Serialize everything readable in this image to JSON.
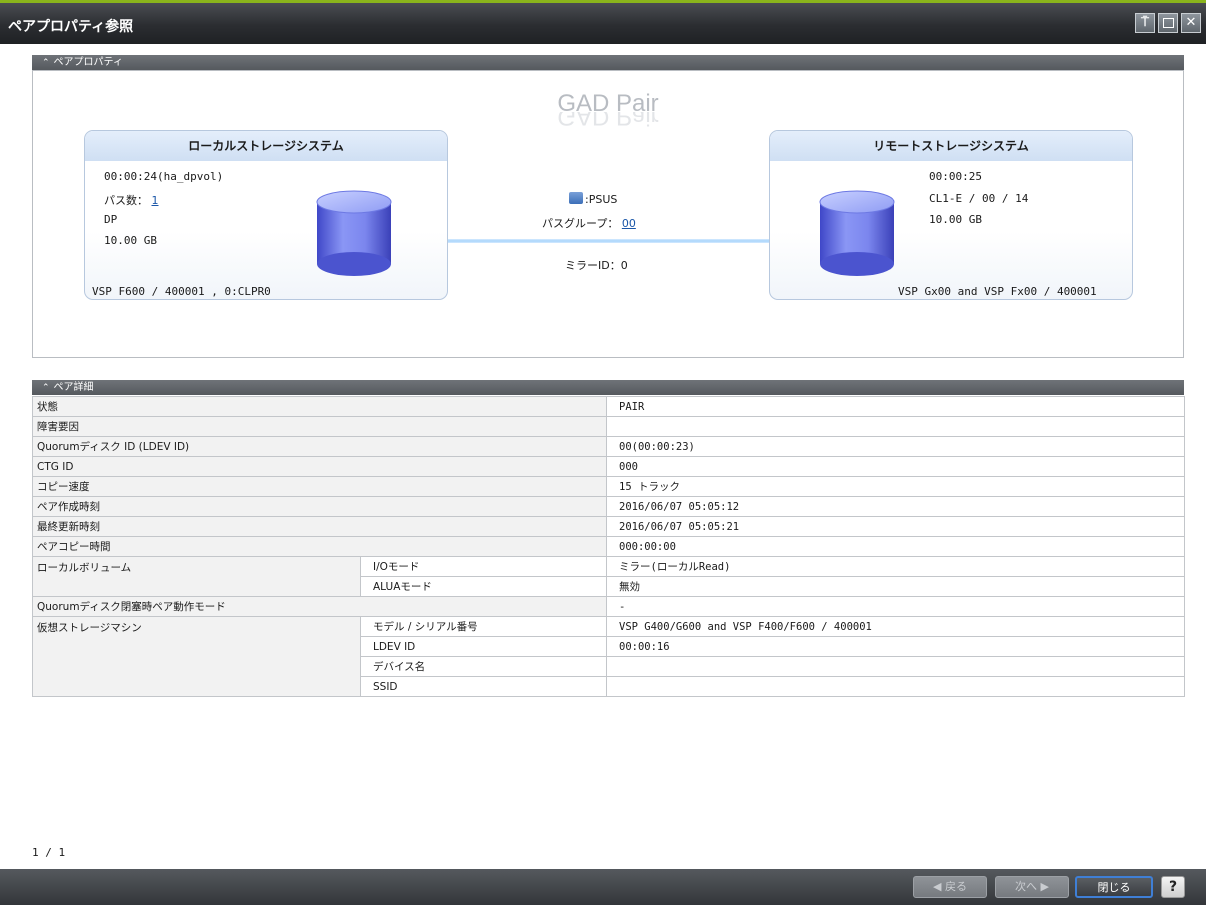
{
  "window": {
    "title": "ペアプロパティ参照",
    "buttons": {
      "pin": "⍑",
      "close": "✕"
    }
  },
  "pair_properties": {
    "section_title": "ペアプロパティ",
    "diagram_title": "GAD Pair",
    "local": {
      "heading": "ローカルストレージシステム",
      "ldev": "00:00:24(ha_dpvol)",
      "path_count_label": "パス数：",
      "path_count": "1",
      "pool_type": "DP",
      "capacity": "10.00 GB",
      "storage": "VSP F600 / 400001 , 0:CLPR0"
    },
    "status": {
      "icon": "pair-status-icon",
      "value": ":PSUS",
      "path_group_label": "パスグループ：",
      "path_group": "00",
      "mirror_id": "ミラーID：0"
    },
    "remote": {
      "heading": "リモートストレージシステム",
      "ldev": "00:00:25",
      "port": "CL1-E / 00 / 14",
      "capacity": "10.00 GB",
      "storage": "VSP Gx00 and VSP Fx00 / 400001"
    },
    "colors": {
      "volume": "#6b78e6",
      "connector": "#a9d4fb"
    }
  },
  "pair_details": {
    "section_title": "ペア詳細",
    "rows": [
      {
        "label": "状態",
        "value": "PAIR"
      },
      {
        "label": "障害要因",
        "value": ""
      },
      {
        "label": "Quorumディスク ID (LDEV ID)",
        "value": "00(00:00:23)"
      },
      {
        "label": "CTG ID",
        "value": "000"
      },
      {
        "label": "コピー速度",
        "value": "15 トラック"
      },
      {
        "label": "ペア作成時刻",
        "value": "2016/06/07 05:05:12"
      },
      {
        "label": "最終更新時刻",
        "value": "2016/06/07 05:05:21"
      },
      {
        "label": "ペアコピー時間",
        "value": "000:00:00"
      }
    ],
    "local_volume": {
      "label": "ローカルボリューム",
      "io_mode_label": "I/Oモード",
      "io_mode": "ミラー(ローカルRead)",
      "alua_label": "ALUAモード",
      "alua": "無効"
    },
    "quorum_mode": {
      "label": "Quorumディスク閉塞時ペア動作モード",
      "value": "-"
    },
    "virtual_storage": {
      "label": "仮想ストレージマシン",
      "model_label": "モデル / シリアル番号",
      "model": "VSP G400/G600 and VSP F400/F600 / 400001",
      "ldev_label": "LDEV ID",
      "ldev": "00:00:16",
      "device_label": "デバイス名",
      "device": "",
      "ssid_label": "SSID",
      "ssid": ""
    }
  },
  "pager": "1 / 1",
  "footer": {
    "back": "◀ 戻る",
    "next": "次へ ▶",
    "close": "閉じる",
    "help": "?"
  }
}
